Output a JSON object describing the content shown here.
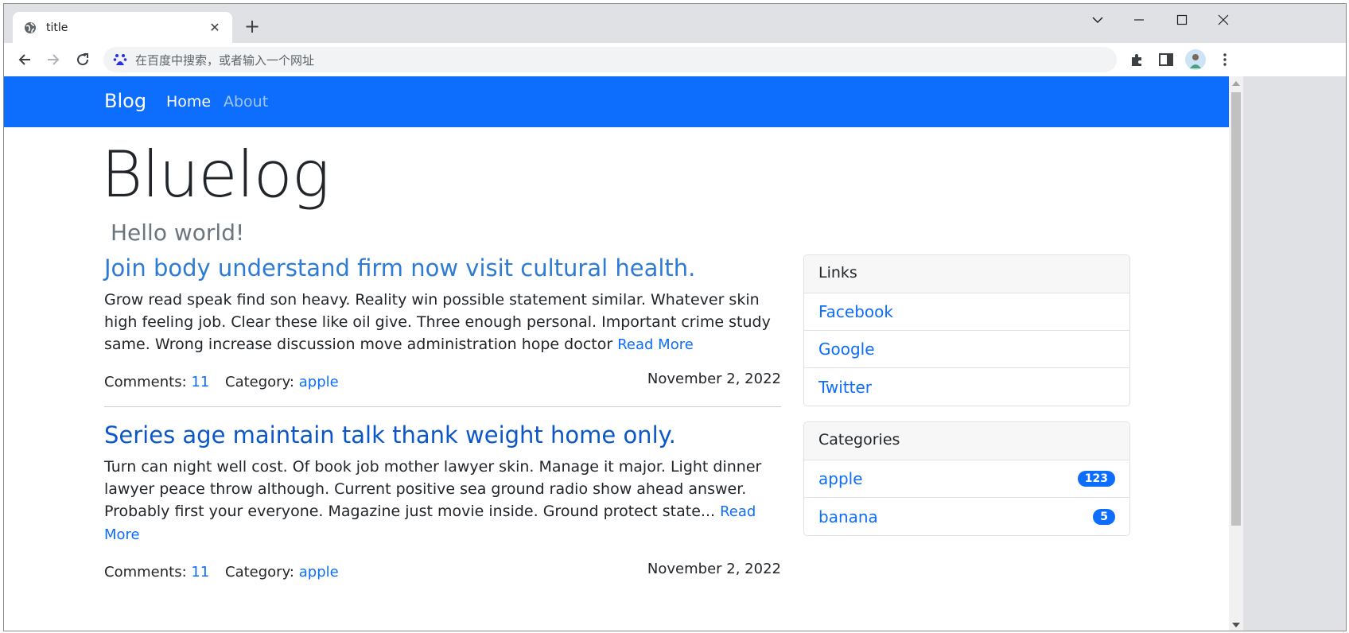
{
  "browser": {
    "tab_title": "title",
    "new_tab_label": "+",
    "omnibox_placeholder": "在百度中搜索，或者输入一个网址"
  },
  "page": {
    "navbar": {
      "brand": "Blog",
      "links": [
        {
          "label": "Home",
          "active": true
        },
        {
          "label": "About",
          "active": false
        }
      ]
    },
    "header": {
      "title": "Bluelog",
      "subtitle": "Hello world!"
    },
    "posts": [
      {
        "title": "Join body understand firm now visit cultural health.",
        "body": "Grow read speak find son heavy. Reality win possible statement similar. Whatever skin high feeling job. Clear these like oil give. Three enough personal. Important crime study same. Wrong increase discussion move administration hope doctor ",
        "read_more": "Read More",
        "comments_label": "Comments:",
        "comments": "11",
        "category_label": "Category:",
        "category": "apple",
        "date": "November 2, 2022",
        "title_color": "#2e7bd6"
      },
      {
        "title": "Series age maintain talk thank weight home only.",
        "body": "Turn can night well cost. Of book job mother lawyer skin. Manage it major. Light dinner lawyer peace throw although. Current positive sea ground radio show ahead answer. Probably first your everyone. Magazine just movie inside. Ground protect state... ",
        "read_more": "Read More",
        "comments_label": "Comments:",
        "comments": "11",
        "category_label": "Category:",
        "category": "apple",
        "date": "November 2, 2022",
        "title_color": "#0b57c9"
      }
    ],
    "sidebar": {
      "links": {
        "heading": "Links",
        "items": [
          "Facebook",
          "Google",
          "Twitter"
        ]
      },
      "categories": {
        "heading": "Categories",
        "items": [
          {
            "name": "apple",
            "count": "123"
          },
          {
            "name": "banana",
            "count": "5"
          }
        ]
      }
    }
  },
  "colors": {
    "navbar": "#0d6efd",
    "link": "#0d6efd",
    "badge": "#0d6efd"
  }
}
